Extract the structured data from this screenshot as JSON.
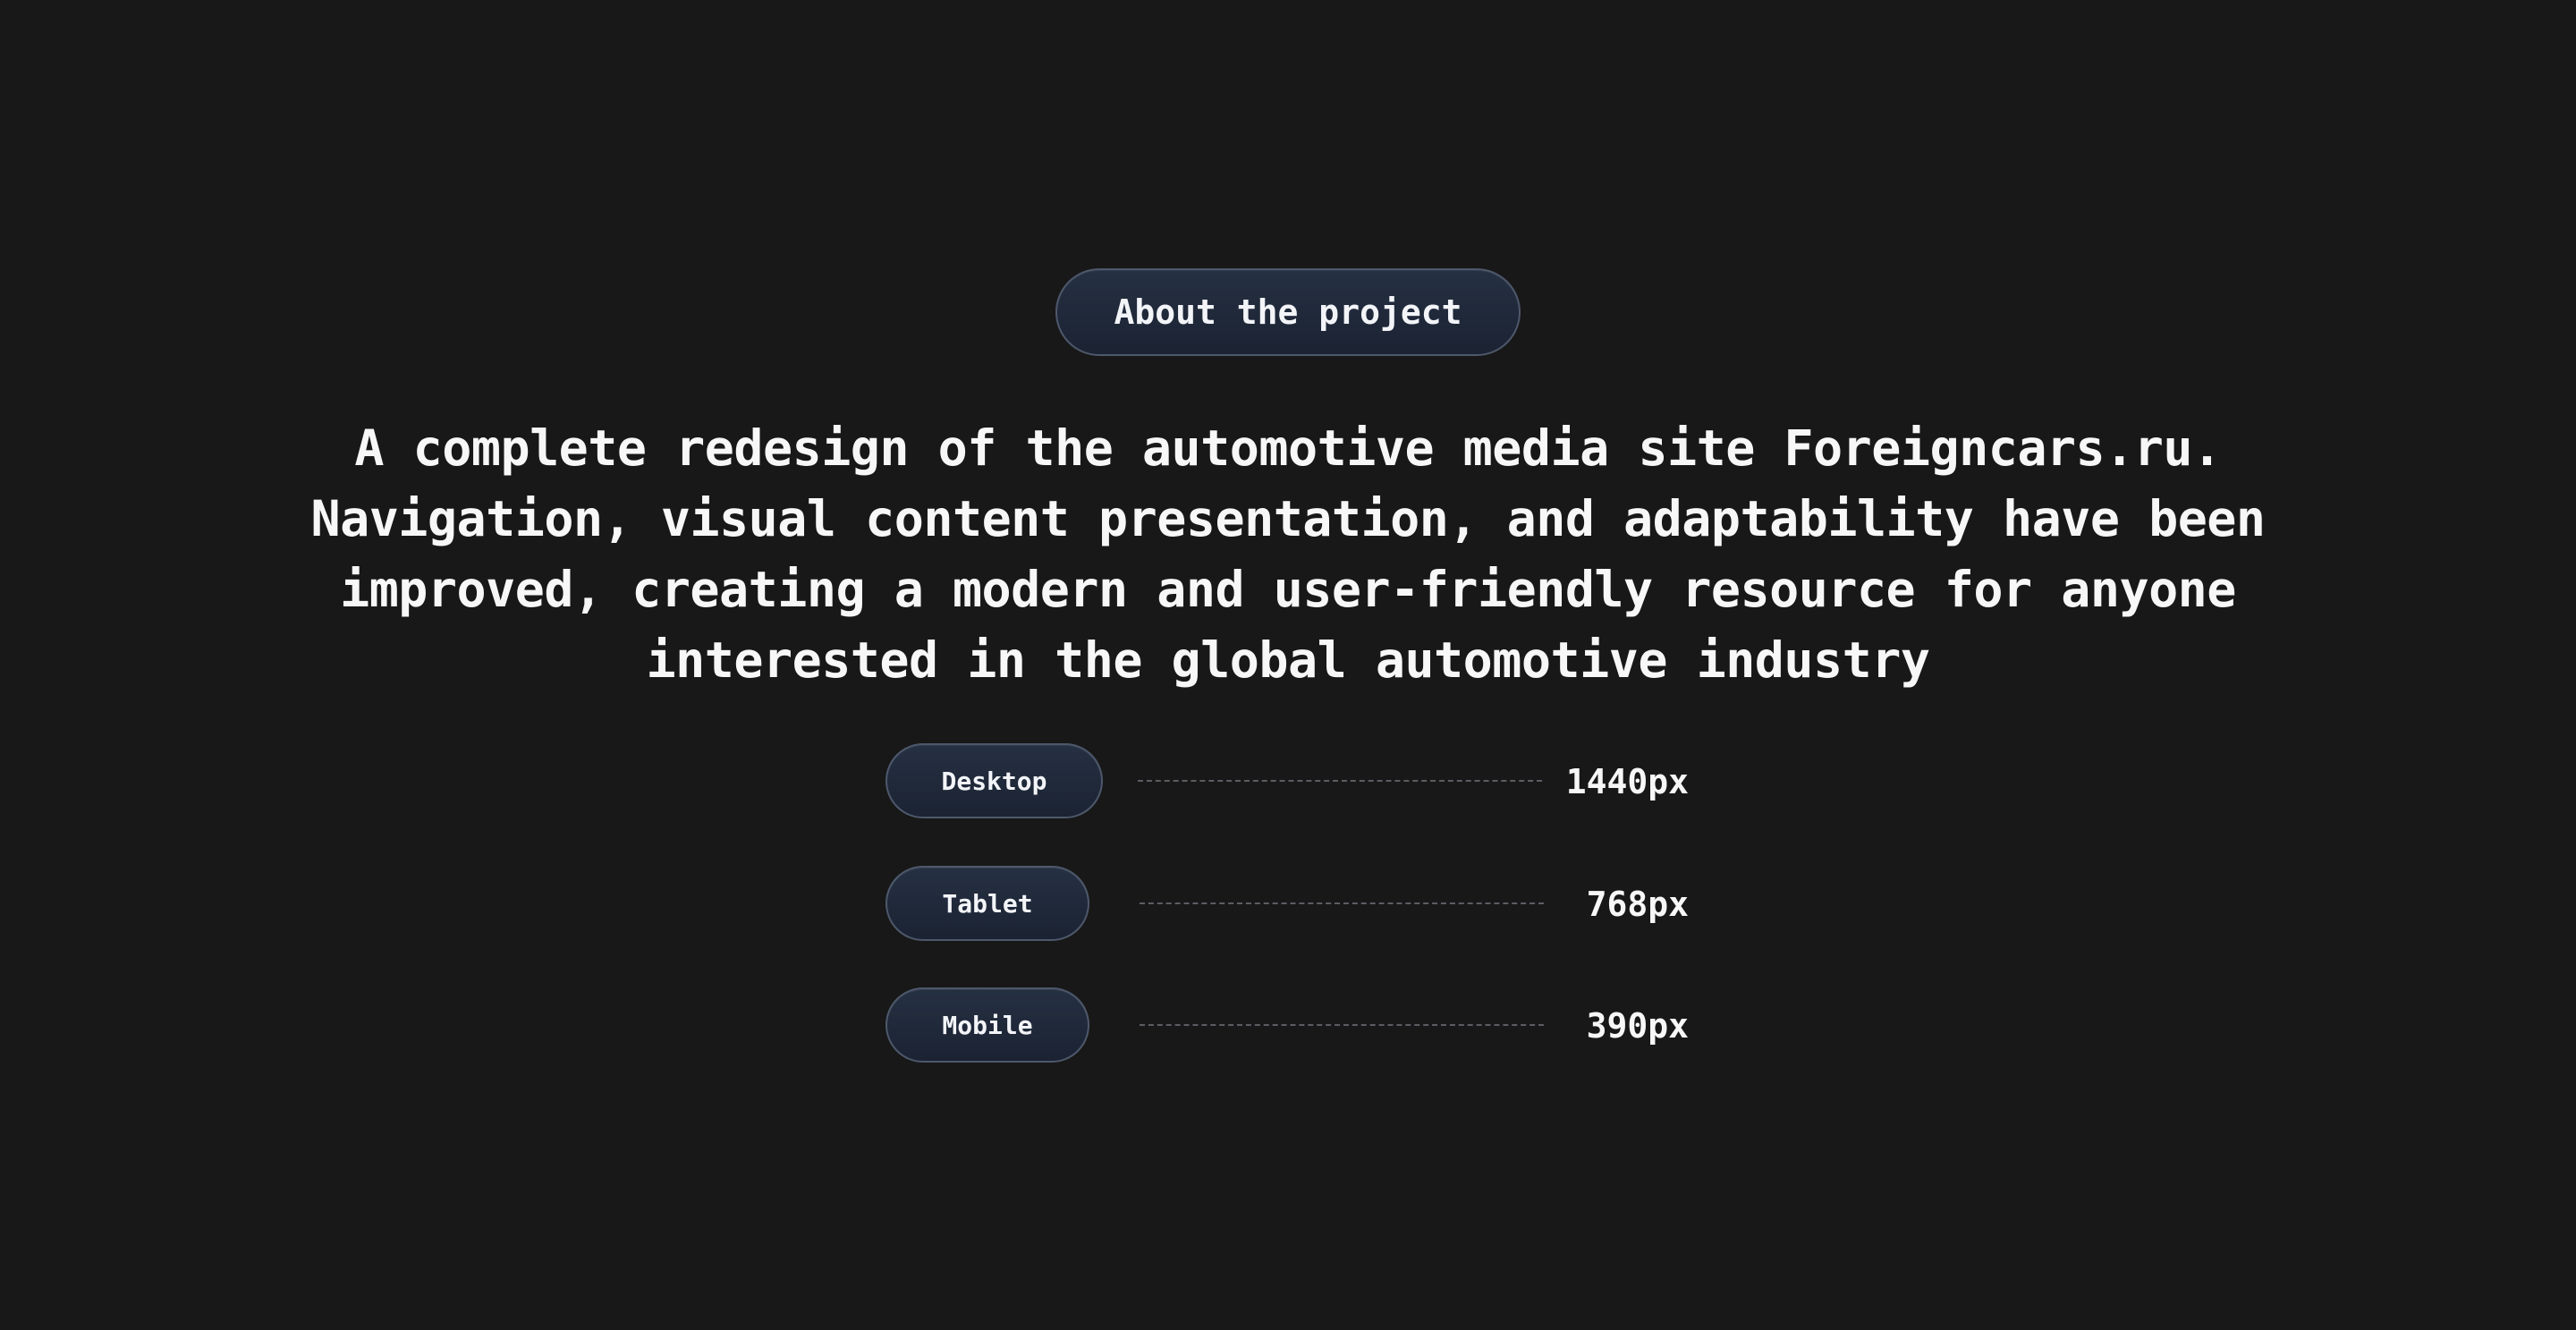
{
  "about_badge": {
    "label": "About the project"
  },
  "headline": {
    "line1": "A complete redesign of the automotive media site Foreigncars.ru.",
    "line2": "Navigation, visual content presentation, and adaptability have been",
    "line3": "improved, creating a modern and user-friendly resource for anyone",
    "line4": "interested in the global automotive industry"
  },
  "breakpoints": [
    {
      "label": "Desktop",
      "value": "1440px"
    },
    {
      "label": "Tablet",
      "value": "768px"
    },
    {
      "label": "Mobile",
      "value": "390px"
    }
  ],
  "colors": {
    "background": "#181818",
    "badge_fill": "#1f2838",
    "badge_border": "#4d586b",
    "text": "#f4f5f7",
    "dash": "#5a5d63"
  }
}
